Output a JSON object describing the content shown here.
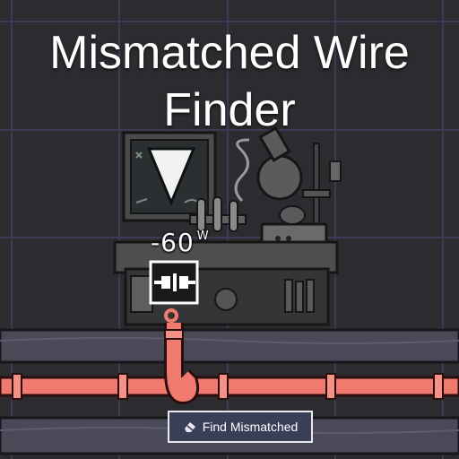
{
  "title": {
    "line1": "Mismatched Wire",
    "line2": "Finder"
  },
  "building": {
    "wattage_value": "-60",
    "wattage_unit": "W"
  },
  "button": {
    "label": "Find Mismatched",
    "icon": "eraser-icon"
  },
  "colors": {
    "background": "#2c2c30",
    "wire": "#f07a6e",
    "button_bg": "#3a3f58",
    "grid": "#3d3b55"
  }
}
